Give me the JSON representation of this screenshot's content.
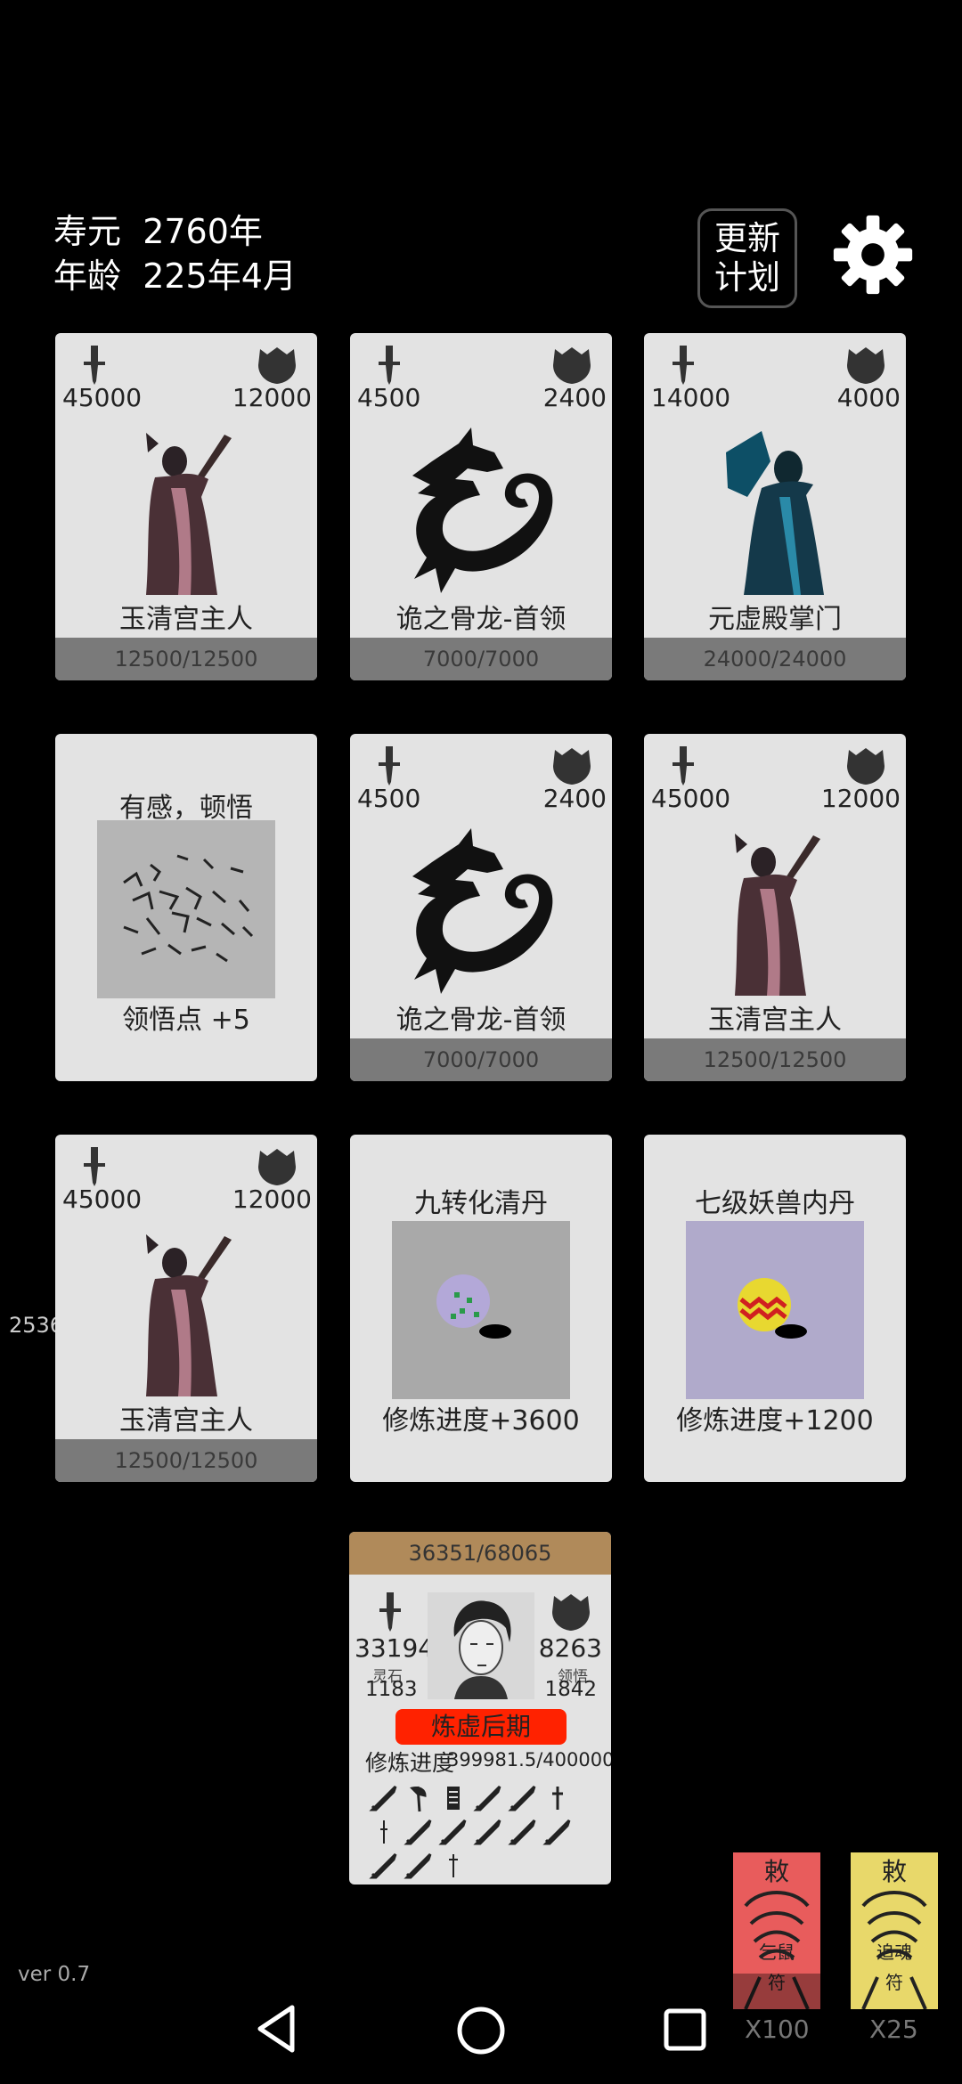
{
  "header": {
    "lifespan_label": "寿元",
    "lifespan_value": "2760年",
    "age_label": "年龄",
    "age_value": "225年4月",
    "update_button_line1": "更新",
    "update_button_line2": "计划"
  },
  "cards": [
    {
      "kind": "enemy",
      "atk": "45000",
      "def": "12000",
      "name": "玉清宫主人",
      "hp": "12500/12500",
      "portrait": "cultivator-master-portrait"
    },
    {
      "kind": "enemy",
      "atk": "4500",
      "def": "2400",
      "name": "诡之骨龙-首领",
      "hp": "7000/7000",
      "portrait": "bone-dragon-portrait"
    },
    {
      "kind": "enemy",
      "atk": "14000",
      "def": "4000",
      "name": "元虚殿掌门",
      "hp": "24000/24000",
      "portrait": "sect-leader-portrait"
    },
    {
      "kind": "event",
      "title": "有感，顿悟",
      "desc": "领悟点  +5",
      "image": "enlightenment-calligraphy-image"
    },
    {
      "kind": "enemy",
      "atk": "4500",
      "def": "2400",
      "name": "诡之骨龙-首领",
      "hp": "7000/7000",
      "portrait": "bone-dragon-portrait"
    },
    {
      "kind": "enemy",
      "atk": "45000",
      "def": "12000",
      "name": "玉清宫主人",
      "hp": "12500/12500",
      "portrait": "cultivator-master-portrait"
    },
    {
      "kind": "enemy",
      "atk": "45000",
      "def": "12000",
      "name": "玉清宫主人",
      "hp": "12500/12500",
      "portrait": "cultivator-master-portrait"
    },
    {
      "kind": "item",
      "title": "九转化清丹",
      "desc": "修炼进度+3600",
      "image": "green-pill-image",
      "bg": "#a9a9a9"
    },
    {
      "kind": "item",
      "title": "七级妖兽内丹",
      "desc": "修炼进度+1200",
      "image": "demon-core-image",
      "bg": "#b0aacb"
    }
  ],
  "side_number": "2536",
  "player": {
    "exp": "36351/68065",
    "atk": "33194",
    "def": "8263",
    "spirit_stone_label": "灵石",
    "spirit_stone_value": "1183",
    "insight_label": "领悟",
    "insight_value": "1842",
    "realm": "炼虚后期",
    "progress_label": "修炼进度",
    "progress_value": "399981.5/400000",
    "equipment_icons": [
      "sword-icon",
      "axe-icon",
      "scroll-icon",
      "sword-icon",
      "sword-icon",
      "dagger-icon",
      "dagger-icon",
      "sword-icon",
      "sword-icon",
      "sword-icon",
      "sword-icon",
      "sword-icon",
      "sword-icon",
      "sword-icon",
      "dagger-icon"
    ],
    "realm_color": "#ff2200",
    "exp_bar_color": "#b08a5a"
  },
  "talismans": [
    {
      "label_top": "敕",
      "label_mid": "乞鼠",
      "label_bottom": "符",
      "count": "X100",
      "color": "#e85c5c"
    },
    {
      "label_top": "敕",
      "label_mid": "追魂",
      "label_bottom": "符",
      "count": "X25",
      "color": "#e8d86a"
    }
  ],
  "version": "ver 0.7",
  "colors": {
    "background": "#000000",
    "card": "#e3e3e3",
    "hp_bar": "#7a7a7a"
  }
}
